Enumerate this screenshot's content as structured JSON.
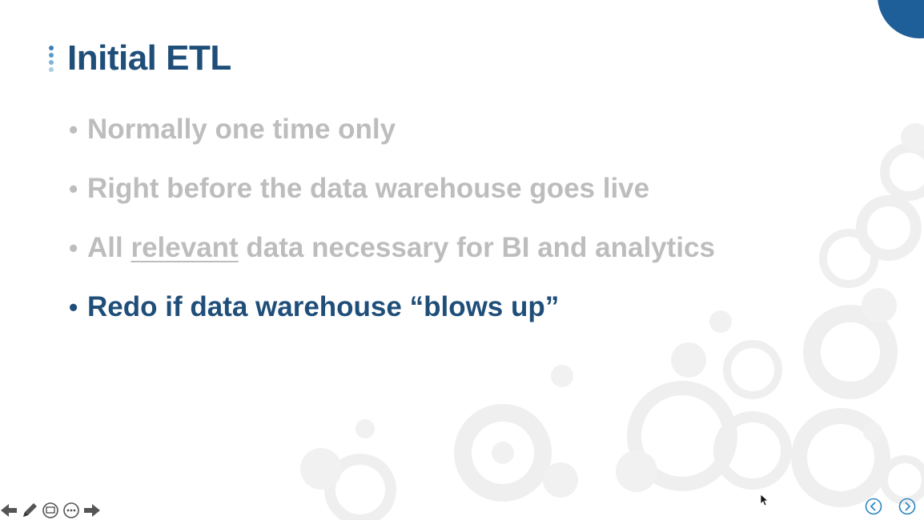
{
  "slide": {
    "title": "Initial ETL",
    "bullets": [
      {
        "text": "Normally one time only",
        "active": false
      },
      {
        "text": "Right before the data warehouse goes live",
        "active": false
      },
      {
        "prefix": "All ",
        "underlined": "relevant",
        "suffix": " data necessary for BI and analytics",
        "active": false
      },
      {
        "text": "Redo if data warehouse “blows up”",
        "active": true
      }
    ]
  },
  "bullet_symbol": "•",
  "colors": {
    "title": "#1f4e79",
    "active_text": "#1f4e79",
    "inactive_text": "#bdbdbd",
    "accent_circle": "#1f5f99",
    "nav_icon": "#2e86c1",
    "controls_icon": "#555555"
  },
  "icons": {
    "controls": [
      "arrow-left-icon",
      "pen-icon",
      "slides-icon",
      "more-icon",
      "arrow-right-icon"
    ],
    "navigation": [
      "previous-slide-icon",
      "next-slide-icon"
    ]
  }
}
